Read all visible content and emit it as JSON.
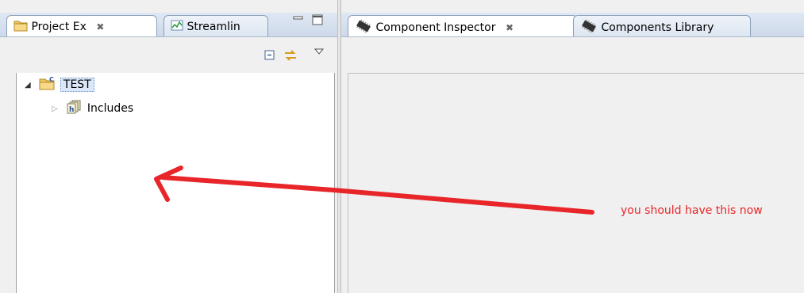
{
  "left_view": {
    "tabs": [
      {
        "label": "Project Ex",
        "active": true
      },
      {
        "label": "Streamlin",
        "active": false
      }
    ],
    "tree": {
      "project": {
        "label": "TEST",
        "expanded": true
      },
      "children": [
        {
          "label": "Includes",
          "expanded": false
        }
      ]
    }
  },
  "right_view": {
    "tabs": [
      {
        "label": "Component Inspector",
        "active": true
      },
      {
        "label": "Components Library",
        "active": false
      }
    ]
  },
  "annotation": {
    "text": "you should have this now",
    "color": "#e8262a"
  },
  "colors": {
    "tab_border": "#8d9fb8",
    "selection": "#dbe8fb",
    "arrow": "#e8262a"
  },
  "icons": {
    "project_explorer_tab": "folder-project-icon",
    "streamline_tab": "chart-icon",
    "inspector_tab": "component-chip-icon",
    "library_tab": "component-chip-icon",
    "collapse_all": "collapse-all-icon",
    "link_editor": "link-with-editor-icon",
    "view_menu": "view-menu-icon",
    "minimize": "minimize-icon",
    "maximize": "maximize-icon"
  }
}
